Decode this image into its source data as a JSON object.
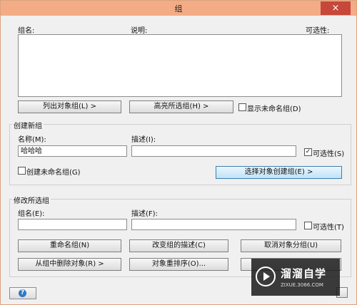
{
  "window": {
    "title": "组",
    "close": "×"
  },
  "list": {
    "col_name": "组名:",
    "col_desc": "说明:",
    "col_selectable": "可选性:"
  },
  "list_buttons": {
    "list_objects": "列出对象组(L) >",
    "highlight": "高亮所选组(H) >",
    "show_unnamed": "显示未命名组(D)",
    "show_unnamed_checked": false
  },
  "create": {
    "group_title": "创建新组",
    "name_label": "名称(M):",
    "name_value": "哈哈哈",
    "desc_label": "描述(I):",
    "desc_value": "",
    "selectable_label": "可选性(S)",
    "selectable_checked": "✓",
    "unnamed_label": "创建未命名组(G)",
    "select_objects_button": "选择对象创建组(E) >"
  },
  "modify": {
    "group_title": "修改所选组",
    "name_label": "组名(E):",
    "name_value": "",
    "desc_label": "描述(F):",
    "desc_value": "",
    "selectable_label": "可选性(T)",
    "rename": "重命名组(N)",
    "change_desc": "改变组的描述(C)",
    "ungroup": "取消对象分组(U)",
    "remove": "从组中删除对象(R) >",
    "reorder": "对象重排序(O)..."
  },
  "help_icon": "?",
  "watermark": {
    "title": "溜溜自学",
    "sub": "ZIXUE.3066.COM"
  }
}
